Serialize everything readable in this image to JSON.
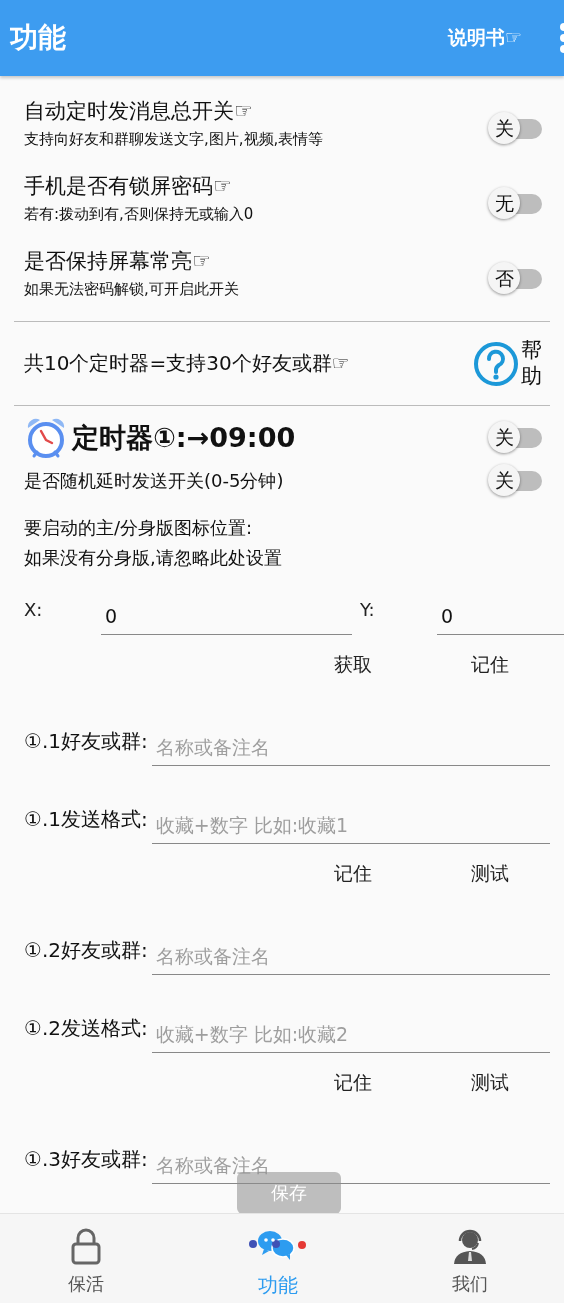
{
  "app_bar": {
    "title": "功能",
    "manual_link": "说明书☞"
  },
  "switches": [
    {
      "title": "自动定时发消息总开关☞",
      "subtitle": "支持向好友和群聊发送文字,图片,视频,表情等",
      "toggle_label": "关",
      "on": false
    },
    {
      "title": "手机是否有锁屏密码☞",
      "subtitle": "若有:拨动到有,否则保持无或输入0",
      "toggle_label": "无",
      "on": false
    },
    {
      "title": "是否保持屏幕常亮☞",
      "subtitle": "如果无法密码解锁,可开启此开关",
      "toggle_label": "否",
      "on": false
    }
  ],
  "banner": {
    "text": "共10个定时器=支持30个好友或群☞",
    "help_label": "帮助"
  },
  "timer": {
    "title": "定时器①:→09:00",
    "toggle_label": "关",
    "on": false,
    "random_delay": {
      "label": "是否随机延时发送开关(0-5分钟)",
      "toggle_label": "关",
      "on": false
    },
    "icon_position_note": [
      "要启动的主/分身版图标位置:",
      "如果没有分身版,请忽略此处设置"
    ],
    "coordinates": [
      {
        "label": "X:",
        "value": "0"
      },
      {
        "label": "Y:",
        "value": "0"
      }
    ],
    "coordinate_buttons": [
      "获取",
      "记住"
    ],
    "entries": [
      {
        "fields": [
          {
            "label": "①.1好友或群:",
            "placeholder": "名称或备注名"
          },
          {
            "label": "①.1发送格式:",
            "placeholder": "收藏+数字 比如:收藏1"
          }
        ],
        "buttons": [
          "记住",
          "测试"
        ]
      },
      {
        "fields": [
          {
            "label": "①.2好友或群:",
            "placeholder": "名称或备注名"
          },
          {
            "label": "①.2发送格式:",
            "placeholder": "收藏+数字 比如:收藏2"
          }
        ],
        "buttons": [
          "记住",
          "测试"
        ]
      },
      {
        "fields": [
          {
            "label": "①.3好友或群:",
            "placeholder": "名称或备注名"
          }
        ]
      }
    ]
  },
  "toast": "保存",
  "bottom_nav": [
    {
      "label": "保活",
      "selected": false
    },
    {
      "label": "功能",
      "selected": true
    },
    {
      "label": "我们",
      "selected": false
    }
  ]
}
